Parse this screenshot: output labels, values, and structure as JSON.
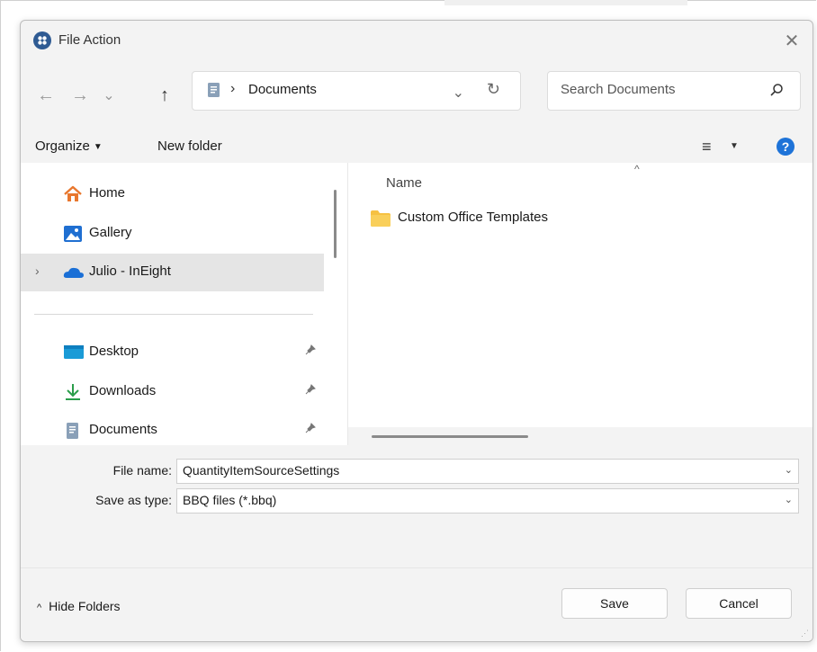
{
  "window": {
    "title": "File Action",
    "close_glyph": "✕"
  },
  "nav": {
    "back_glyph": "←",
    "forward_glyph": "→",
    "recent_glyph": "⌄",
    "up_glyph": "↑",
    "path_separator": "›",
    "location": "Documents",
    "refresh_glyph": "↻",
    "dropdown_glyph": "⌄"
  },
  "search": {
    "placeholder": "Search Documents"
  },
  "toolbar": {
    "organize_label": "Organize",
    "new_folder_label": "New folder",
    "view_glyph": "≡",
    "dropdown_caret": "▼",
    "help_glyph": "?"
  },
  "sidebar": {
    "items": [
      {
        "label": "Home",
        "icon": "home-icon"
      },
      {
        "label": "Gallery",
        "icon": "gallery-icon"
      },
      {
        "label": "Julio - InEight",
        "icon": "onedrive-cloud-icon",
        "selected": true,
        "expand_glyph": "›"
      },
      {
        "label": "Desktop",
        "icon": "desktop-icon",
        "pinned": true
      },
      {
        "label": "Downloads",
        "icon": "downloads-icon",
        "pinned": true
      },
      {
        "label": "Documents",
        "icon": "documents-icon",
        "pinned": true
      }
    ],
    "pin_glyph": "📌"
  },
  "content": {
    "column_header": "Name",
    "sort_glyph": "^",
    "files": [
      {
        "name": "Custom Office Templates",
        "type": "folder"
      }
    ]
  },
  "form": {
    "file_name_label": "File name:",
    "file_name_value": "QuantityItemSourceSettings",
    "save_type_label": "Save as type:",
    "save_type_value": "BBQ files (*.bbq)",
    "dropdown_glyph": "⌄"
  },
  "footer": {
    "hide_folders_label": "Hide Folders",
    "hide_folders_glyph": "^",
    "save_label": "Save",
    "cancel_label": "Cancel"
  },
  "colors": {
    "accent": "#1e73d8",
    "folder": "#f6c142",
    "selection": "#e5e5e5"
  }
}
